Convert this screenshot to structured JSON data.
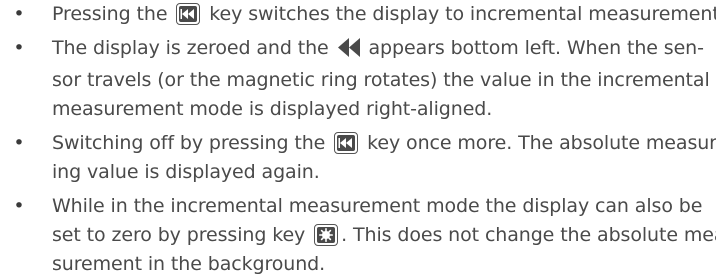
{
  "bullet_char": "•",
  "bullets": [
    {
      "lines": [
        {
          "before": "Pressing the",
          "icon": "incremental-key-icon",
          "after": "key switches the display to incremental measurement."
        }
      ]
    },
    {
      "lines": [
        {
          "before": "The display is zeroed and the",
          "icon": "incremental-symbol-icon",
          "after": "appears bottom left. When the sen-"
        },
        {
          "text": "sor travels (or the magnetic ring rotates) the value in the incremental"
        },
        {
          "text": "measurement mode is displayed right-aligned."
        }
      ]
    },
    {
      "lines": [
        {
          "before": "Switching off by pressing the",
          "icon": "incremental-key-icon",
          "after": "key once more. The absolute measur-"
        },
        {
          "text": "ing value is displayed again."
        }
      ]
    },
    {
      "lines": [
        {
          "text": "While in the incremental measurement mode the display can also be"
        },
        {
          "before": "set to zero by pressing key",
          "icon": "star-key-icon",
          "after": ". This does not change the absolute mea-"
        },
        {
          "text": "surement in the background."
        }
      ]
    }
  ],
  "colors": {
    "text": "#4a4a4a",
    "key_fill": "#4a4a4a",
    "key_border": "#555555",
    "symbol": "#4a4a4a"
  }
}
